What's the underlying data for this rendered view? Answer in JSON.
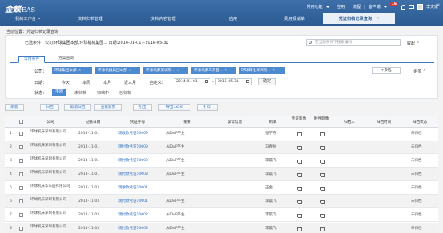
{
  "app": {
    "logo": "金蝶",
    "logo_sub": "EAS",
    "top_links": [
      "常用功能",
      "应用",
      "流程",
      "客户端"
    ],
    "badge": "16",
    "user": "李文家"
  },
  "tabs": [
    {
      "label": "我的工作台",
      "dropdown": true
    },
    {
      "label": "文档归档管理",
      "dropdown": false
    },
    {
      "label": "文档内容管理",
      "dropdown": false
    },
    {
      "label": "应用",
      "dropdown": false
    },
    {
      "label": "费用报销单",
      "dropdown": false
    },
    {
      "label": "凭证归档记录查询",
      "dropdown": false,
      "active": true
    }
  ],
  "breadcrumb": "当前位置：凭证归档记录查询",
  "filter": {
    "condition": "已选条件：公司:环球集团本部,环球机械集团...   日期:2014-01-01－2016-05-31",
    "search_placeholder": "在当前条件下搜索编码",
    "collapse": "收起",
    "tabs": [
      "常用条件",
      "方案查询"
    ],
    "company_label": "公司：",
    "companies": [
      "环球集团本部",
      "环球机械集团本部",
      "环球机床深圳有...",
      "环球机床华东园...",
      "环球日化深圳有..."
    ],
    "multi_label": "+多选",
    "more_label": "更多",
    "date_label": "日期：",
    "date_opts": [
      "今天",
      "本周",
      "本月",
      "近三月",
      "自定义："
    ],
    "date_from": "2014-01-01",
    "date_to": "2016-05-31",
    "ok_label": "确定",
    "status_label": "状态：",
    "status_opts": [
      "不限",
      "未归档",
      "归档中",
      "已归档"
    ]
  },
  "toolbar": [
    "刷新",
    "归档",
    "取消归档",
    "查看影像",
    "引出",
    "导出Excel",
    "打印"
  ],
  "table": {
    "columns": [
      "公司",
      "记账日期",
      "凭证字号",
      "摘要",
      "异常信息",
      "制单",
      "凭证影像",
      "附件影像",
      "归档人",
      "归档时间",
      "归档状态"
    ],
    "rows": [
      {
        "no": "1",
        "company": "环球机床深圳有限公司",
        "date": "2014-11-01",
        "voucher": "现收款凭证10009",
        "summary": "从DAP产生",
        "maker": "张学方",
        "status": "未归档"
      },
      {
        "no": "2",
        "company": "环球机床深圳有限公司",
        "date": "2014-11-01",
        "voucher": "现付款凭证10009",
        "summary": "从DAP产生",
        "maker": "马春秋",
        "status": "未归档"
      },
      {
        "no": "3",
        "company": "环球机床深圳有限公司",
        "date": "2014-11-01",
        "voucher": "现付款凭证10002",
        "summary": "从DAP产生",
        "maker": "李晨飞",
        "status": "未归档"
      },
      {
        "no": "4",
        "company": "环球机床深圳有限公司",
        "date": "2014-11-01",
        "voucher": "现付款凭证10008",
        "summary": "从DAP产生",
        "maker": "李晨飞",
        "status": "未归档"
      },
      {
        "no": "5",
        "company": "环球机床华东园有限公司",
        "date": "2014-11-03",
        "voucher": "现收款凭证10001",
        "summary": "",
        "maker": "王金",
        "status": "未归档"
      },
      {
        "no": "6",
        "company": "环球机床深圳有限公司",
        "date": "2014-11-03",
        "voucher": "现付款凭证10001",
        "summary": "从DAP产生",
        "maker": "李晨飞",
        "status": "未归档"
      },
      {
        "no": "7",
        "company": "环球机床深圳有限公司",
        "date": "2014-11-03",
        "voucher": "现付款凭证10002",
        "summary": "从DAP产生",
        "maker": "李晨飞",
        "status": "未归档"
      },
      {
        "no": "8",
        "company": "环球机床深圳有限公司",
        "date": "2014-11-03",
        "voucher": "现付款凭证10003",
        "summary": "从DAP产生",
        "maker": "李晨飞",
        "status": "未归档"
      }
    ]
  }
}
